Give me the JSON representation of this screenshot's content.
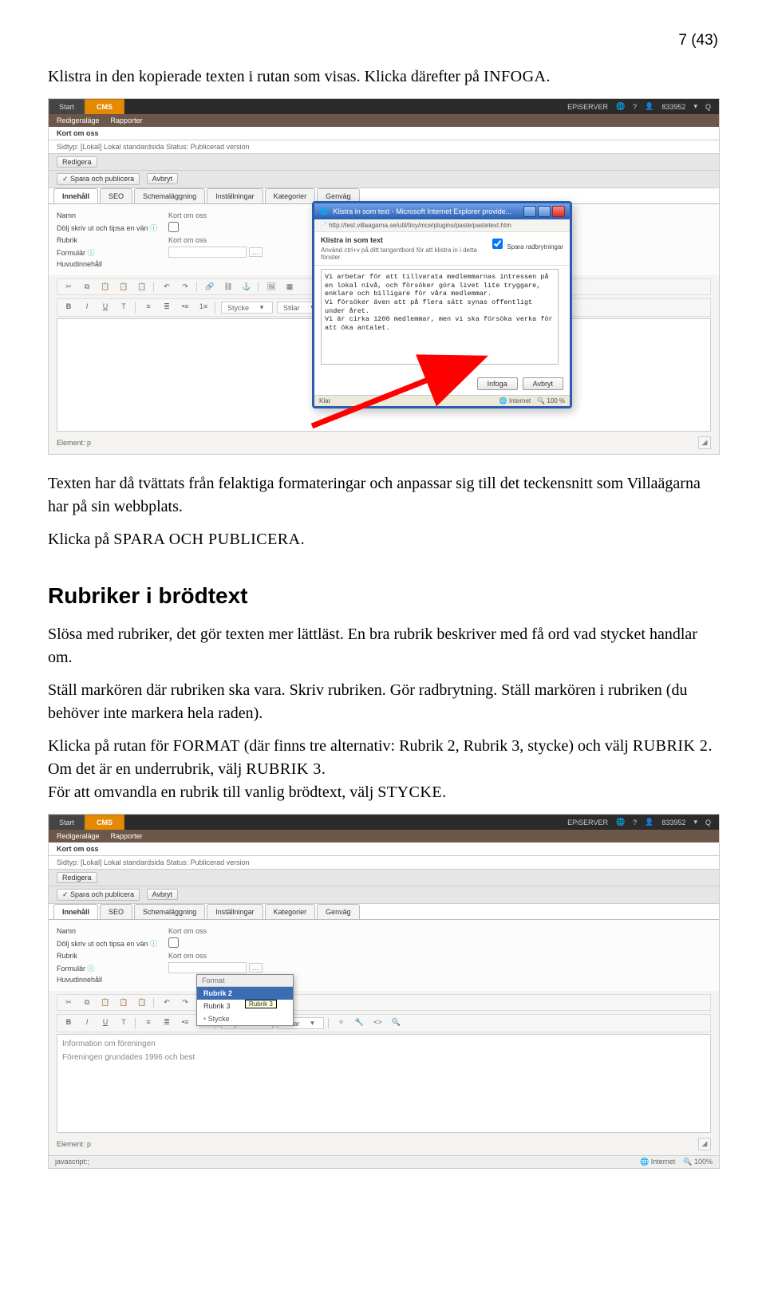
{
  "page_number": "7 (43)",
  "intro_text": "Klistra in den kopierade texten i rutan som visas. Klicka därefter på ",
  "intro_smallcaps": "INFOGA",
  "intro_end": ".",
  "after_shot1_p1": "Texten har då tvättats från felaktiga formateringar och anpassar sig till det teckensnitt som Villaägarna har på sin webbplats.",
  "after_shot1_p2a": "Klicka på ",
  "after_shot1_p2b": "SPARA OCH PUBLICERA",
  "after_shot1_p2c": ".",
  "section_heading": "Rubriker i brödtext",
  "sec_p1": "Slösa med rubriker, det gör texten mer lättläst. En bra rubrik beskriver med få ord vad stycket handlar om.",
  "sec_p2": "Ställ markören där rubriken ska vara. Skriv rubriken. Gör radbrytning. Ställ markören i rubriken (du behöver inte markera hela raden).",
  "sec_p3a": "Klicka på rutan för ",
  "sec_p3b": "FORMAT",
  "sec_p3c": " (där finns tre alternativ: Rubrik 2, Rubrik 3, stycke) och välj ",
  "sec_p3d": "RUBRIK 2",
  "sec_p3e": ".",
  "sec_p4a": "Om det är en underrubrik, välj ",
  "sec_p4b": "RUBRIK 3",
  "sec_p4c": ".",
  "sec_p5a": "För att omvandla en rubrik till vanlig brödtext, välj ",
  "sec_p5b": "STYCKE",
  "sec_p5c": ".",
  "cms": {
    "tab_start": "Start",
    "tab_cms": "CMS",
    "brand": "EPiSERVER",
    "help_icon": "?",
    "user_id": "833952",
    "search_icon": "Q",
    "mode_edit": "Redigeraläge",
    "mode_reports": "Rapporter",
    "title": "Kort om oss",
    "sidtype_line": "Sidtyp: [Lokal] Lokal standardsida  Status: Publicerad version",
    "btn_edit": "Redigera",
    "btn_save_publish": "Spara och publicera",
    "btn_cancel": "Avbryt",
    "tabs": [
      "Innehåll",
      "SEO",
      "Schemaläggning",
      "Inställningar",
      "Kategorier",
      "Genväg"
    ],
    "form": {
      "name_lbl": "Namn",
      "name_val": "Kort om oss",
      "hide_lbl": "Dölj skriv ut och tipsa en vän",
      "rubrik_lbl": "Rubrik",
      "rubrik_val": "Kort om oss",
      "formular_lbl": "Formulär",
      "huvud_lbl": "Huvudinnehåll"
    },
    "toolbar_labels": {
      "bold": "B",
      "italic": "I",
      "underline": "U",
      "tt": "T",
      "combo_stycke": "Stycke",
      "combo_stilar": "Stilar"
    },
    "element_label": "Element: p",
    "editor_lines": [
      "Information om föreningen",
      "Föreningen grundades 1996 och best"
    ]
  },
  "dialog": {
    "title": "Klistra in som text - Microsoft Internet Explorer provide...",
    "url": "http://test.villaagarna.se/util/tiny/mce/plugins/paste/pastetext.htm",
    "heading": "Klistra in som text",
    "keep_breaks": "Spara radbrytningar",
    "hint": "Använd ctrl+v på ditt tangentbord för att klistra in i detta fönster.",
    "textarea": "Vi arbetar för att tillvarata medlemmarnas intressen på en lokal nivå, och försöker göra livet lite tryggare, enklare och billigare för våra medlemmar.\nVi försöker även att på flera sätt synas offentligt under året.\nVi är cirka 1200 medlemmar, men vi ska försöka verka för att öka antalet.",
    "btn_insert": "Infoga",
    "btn_cancel": "Avbryt",
    "status_left": "Klar",
    "status_right1": "Internet",
    "status_right2": "100 %"
  },
  "fmt": {
    "header": "Format",
    "r2": "Rubrik 2",
    "r3": "Rubrik 3",
    "stycke": "Stycke",
    "tooltip": "Rubrik 3"
  },
  "footer": {
    "left": "javascript:;",
    "internet": "Internet",
    "zoom": "100%"
  }
}
